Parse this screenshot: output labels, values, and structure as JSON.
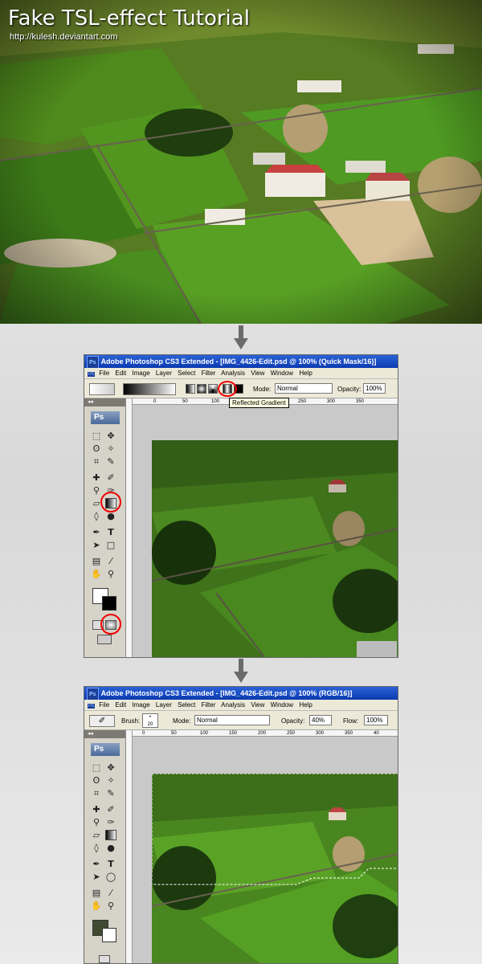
{
  "header": {
    "title": "Fake TSL-effect Tutorial",
    "url": "http://kulesh.deviantart.com"
  },
  "window1": {
    "title": "Adobe Photoshop CS3 Extended - [IMG_4426-Edit.psd @ 100% (Quick Mask/16)]",
    "menu": [
      "File",
      "Edit",
      "Image",
      "Layer",
      "Select",
      "Filter",
      "Analysis",
      "View",
      "Window",
      "Help"
    ],
    "mode_label": "Mode:",
    "mode_value": "Normal",
    "opacity_label": "Opacity:",
    "opacity_value": "100%",
    "tooltip": "Reflected Gradient",
    "ruler": [
      "0",
      "50",
      "100",
      "150",
      "200",
      "250",
      "300",
      "350"
    ]
  },
  "window2": {
    "title": "Adobe Photoshop CS3 Extended - [IMG_4426-Edit.psd @ 100% (RGB/16)]",
    "menu": [
      "File",
      "Edit",
      "Image",
      "Layer",
      "Select",
      "Filter",
      "Analysis",
      "View",
      "Window",
      "Help"
    ],
    "brush_label": "Brush:",
    "brush_size": "20",
    "mode_label": "Mode:",
    "mode_value": "Normal",
    "opacity_label": "Opacity:",
    "opacity_value": "40%",
    "flow_label": "Flow:",
    "flow_value": "100%",
    "ruler": [
      "0",
      "50",
      "100",
      "150",
      "200",
      "250",
      "300",
      "350",
      "40"
    ]
  },
  "toolbox": {
    "logo": "Ps"
  },
  "colors": {
    "grass": "#4f8a1e",
    "dark_grass": "#2f5a12",
    "highlight": "#e00000",
    "titlebar": "#0c3ab0"
  }
}
